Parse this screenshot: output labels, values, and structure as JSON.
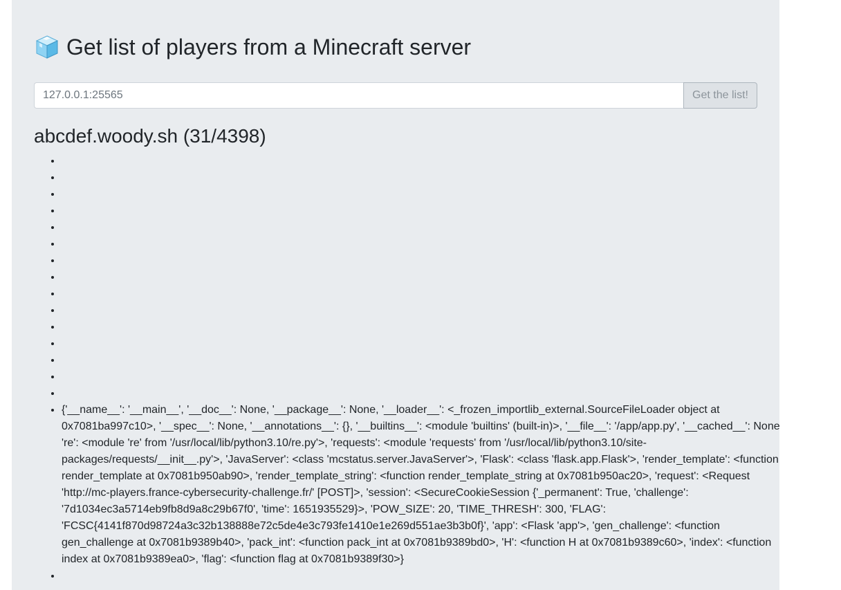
{
  "page": {
    "title": "Get list of players from a Minecraft server",
    "title_icon": "ice-cube-icon"
  },
  "form": {
    "input_placeholder": "127.0.0.1:25565",
    "input_value": "",
    "button_label": "Get the list!"
  },
  "result": {
    "heading": "abcdef.woody.sh (31/4398)",
    "players": [
      "",
      "",
      "",
      "",
      "",
      "",
      "",
      "",
      "",
      "",
      "",
      "",
      "",
      "",
      "",
      "{'__name__': '__main__', '__doc__': None, '__package__': None, '__loader__': <_frozen_importlib_external.SourceFileLoader object at 0x7081ba997c10>, '__spec__': None, '__annotations__': {}, '__builtins__': <module 'builtins' (built-in)>, '__file__': '/app/app.py', '__cached__': None, 're': <module 're' from '/usr/local/lib/python3.10/re.py'>, 'requests': <module 'requests' from '/usr/local/lib/python3.10/site-packages/requests/__init__.py'>, 'JavaServer': <class 'mcstatus.server.JavaServer'>, 'Flask': <class 'flask.app.Flask'>, 'render_template': <function render_template at 0x7081b950ab90>, 'render_template_string': <function render_template_string at 0x7081b950ac20>, 'request': <Request 'http://mc-players.france-cybersecurity-challenge.fr/' [POST]>, 'session': <SecureCookieSession {'_permanent': True, 'challenge': '7d1034ec3a5714eb9fb8d9a8c29b67f0', 'time': 1651935529}>, 'POW_SIZE': 20, 'TIME_THRESH': 300, 'FLAG': 'FCSC{4141f870d98724a3c32b138888e72c5de4e3c793fe1410e1e269d551ae3b3b0f}', 'app': <Flask 'app'>, 'gen_challenge': <function gen_challenge at 0x7081b9389b40>, 'pack_int': <function pack_int at 0x7081b9389bd0>, 'H': <function H at 0x7081b9389c60>, 'index': <function index at 0x7081b9389ea0>, 'flag': <function flag at 0x7081b9389f30>}",
      ""
    ]
  }
}
